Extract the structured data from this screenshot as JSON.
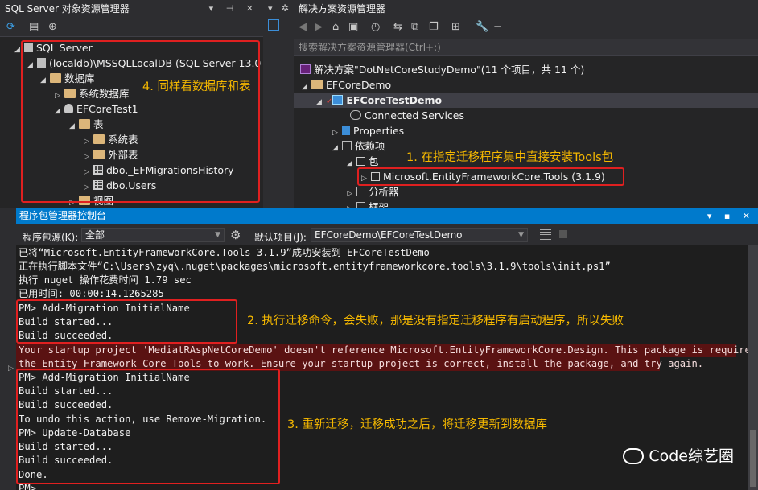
{
  "sql_explorer": {
    "title": "SQL Server 对象资源管理器",
    "title_ctrls": "▾ ⊣ ✕",
    "tree": [
      {
        "label": "SQL Server"
      },
      {
        "label": "(localdb)\\MSSQLLocalDB (SQL Server 13.0"
      },
      {
        "label": "数据库"
      },
      {
        "label": "系统数据库"
      },
      {
        "label": "EFCoreTest1"
      },
      {
        "label": "表"
      },
      {
        "label": "系统表"
      },
      {
        "label": "外部表"
      },
      {
        "label": "dbo._EFMigrationsHistory"
      },
      {
        "label": "dbo.Users"
      },
      {
        "label": "视图"
      }
    ]
  },
  "solution_explorer": {
    "title": "解决方案资源管理器",
    "search_placeholder": "搜索解决方案资源管理器(Ctrl+;)",
    "tree": [
      {
        "label": "解决方案\"DotNetCoreStudyDemo\"(11 个项目，共 11 个)"
      },
      {
        "label": "EFCoreDemo"
      },
      {
        "label": "EFCoreTestDemo"
      },
      {
        "label": "Connected Services"
      },
      {
        "label": "Properties"
      },
      {
        "label": "依赖项"
      },
      {
        "label": "包"
      },
      {
        "label": "Microsoft.EntityFrameworkCore.Tools (3.1.9)"
      },
      {
        "label": "分析器"
      },
      {
        "label": "框架"
      }
    ]
  },
  "console": {
    "title": "程序包管理器控制台",
    "title_ctrls": "▾ ▪ ✕",
    "source_label": "程序包源(K):",
    "source_value": "全部",
    "project_label": "默认项目(J):",
    "project_value": "EFCoreDemo\\EFCoreTestDemo",
    "lines": [
      "已将“Microsoft.EntityFrameworkCore.Tools 3.1.9”成功安装到 EFCoreTestDemo",
      "正在执行脚本文件“C:\\Users\\zyq\\.nuget\\packages\\microsoft.entityframeworkcore.tools\\3.1.9\\tools\\init.ps1”",
      "执行 nuget 操作花费时间 1.79 sec",
      "已用时间: 00:00:14.1265285",
      "PM> Add-Migration InitialName",
      "Build started...",
      "Build succeeded.",
      "Your startup project 'MediatRAspNetCoreDemo' doesn't reference Microsoft.EntityFrameworkCore.Design. This package is required for",
      "the Entity Framework Core Tools to work. Ensure your startup project is correct, install the package, and try again.",
      "PM> Add-Migration InitialName",
      "Build started...",
      "Build succeeded.",
      "To undo this action, use Remove-Migration.",
      "PM> Update-Database",
      "Build started...",
      "Build succeeded.",
      "Done.",
      "PM>"
    ]
  },
  "annotations": {
    "a1": "1. 在指定迁移程序集中直接安装Tools包",
    "a2": "2. 执行迁移命令，会失败，那是没有指定迁移程序有启动程序，所以失败",
    "a3": "3. 重新迁移，迁移成功之后，将迁移更新到数据库",
    "a4": "4. 同样看数据库和表"
  },
  "watermark": "Code综艺圈",
  "colors": {
    "annotation": "#f5b800",
    "highlight_box": "#e02020",
    "error_bg": "#5a1212",
    "accent": "#007acc"
  }
}
